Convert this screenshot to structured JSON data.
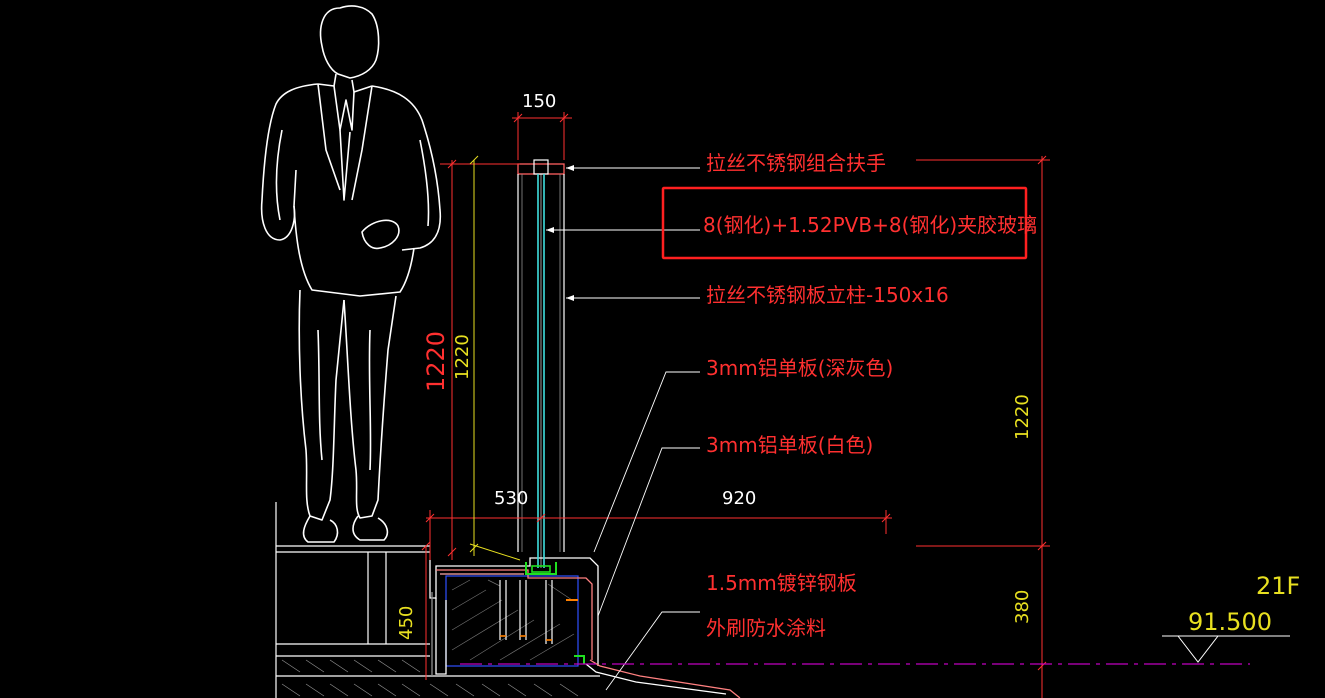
{
  "annotations": {
    "handrail": "拉丝不锈钢组合扶手",
    "glass": "8(钢化)+1.52PVB+8(钢化)夹胶玻璃",
    "post": "拉丝不锈钢板立柱-150x16",
    "panel_dark": "3mm铝单板(深灰色)",
    "panel_white": "3mm铝单板(白色)",
    "galv_line1": "1.5mm镀锌钢板",
    "galv_line2": "外刷防水涂料"
  },
  "dimensions": {
    "top_width": "150",
    "height_left_red": "1220",
    "height_left_yellow": "1220",
    "height_right": "1220",
    "span_left": "530",
    "span_right": "920",
    "curb_height": "450",
    "base_height": "380"
  },
  "level": {
    "floor": "21F",
    "elevation": "91.500"
  },
  "colors": {
    "background": "#000000",
    "annotation_red": "#ff3030",
    "dimension_yellow": "#e8e020",
    "line_white": "#ffffff",
    "glass_cyan": "#40e0e0",
    "highlight_box": "#ff2020",
    "section_line_magenta": "#c000c0",
    "green_detail": "#20e020",
    "orange_detail": "#ff8000",
    "hatch_blue": "#3050ff"
  }
}
